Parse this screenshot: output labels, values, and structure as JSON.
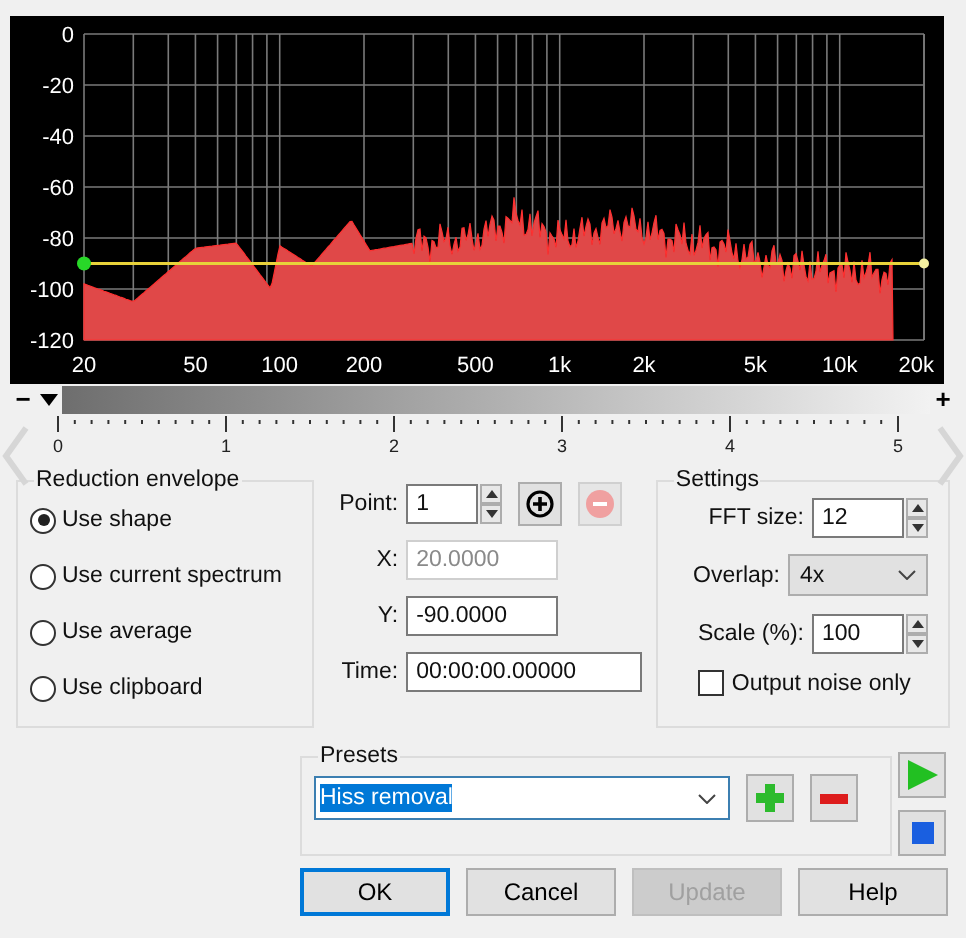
{
  "spectrum": {
    "y_ticks": [
      "0",
      "-20",
      "-40",
      "-60",
      "-80",
      "-100",
      "-120"
    ],
    "x_ticks": [
      "20",
      "50",
      "100",
      "200",
      "500",
      "1k",
      "2k",
      "5k",
      "10k",
      "20k"
    ]
  },
  "zoom_bar": {
    "minus": "−",
    "plus": "+"
  },
  "ruler": [
    "0",
    "1",
    "2",
    "3",
    "4",
    "5"
  ],
  "reduction_envelope": {
    "title": "Reduction envelope",
    "options": [
      {
        "label": "Use shape",
        "selected": true
      },
      {
        "label": "Use current spectrum",
        "selected": false
      },
      {
        "label": "Use average",
        "selected": false
      },
      {
        "label": "Use clipboard",
        "selected": false
      }
    ]
  },
  "point": {
    "label": "Point:",
    "value": "1",
    "remove_disabled": true
  },
  "fields": [
    {
      "label": "X:",
      "value": "20.0000",
      "disabled": true
    },
    {
      "label": "Y:",
      "value": "-90.0000",
      "disabled": false
    },
    {
      "label": "Time:",
      "value": "00:00:00.00000",
      "disabled": false
    }
  ],
  "settings": {
    "title": "Settings",
    "fft_size": {
      "label": "FFT size:",
      "value": "12"
    },
    "overlap": {
      "label": "Overlap:",
      "value": "4x"
    },
    "scale": {
      "label": "Scale (%):",
      "value": "100"
    },
    "output_noise_only": {
      "label": "Output noise only",
      "checked": false
    }
  },
  "presets": {
    "title": "Presets",
    "value": "Hiss removal"
  },
  "buttons": [
    {
      "label": "OK",
      "default": true,
      "disabled": false
    },
    {
      "label": "Cancel",
      "default": false,
      "disabled": false
    },
    {
      "label": "Update",
      "default": false,
      "disabled": true
    },
    {
      "label": "Help",
      "default": false,
      "disabled": false
    }
  ]
}
